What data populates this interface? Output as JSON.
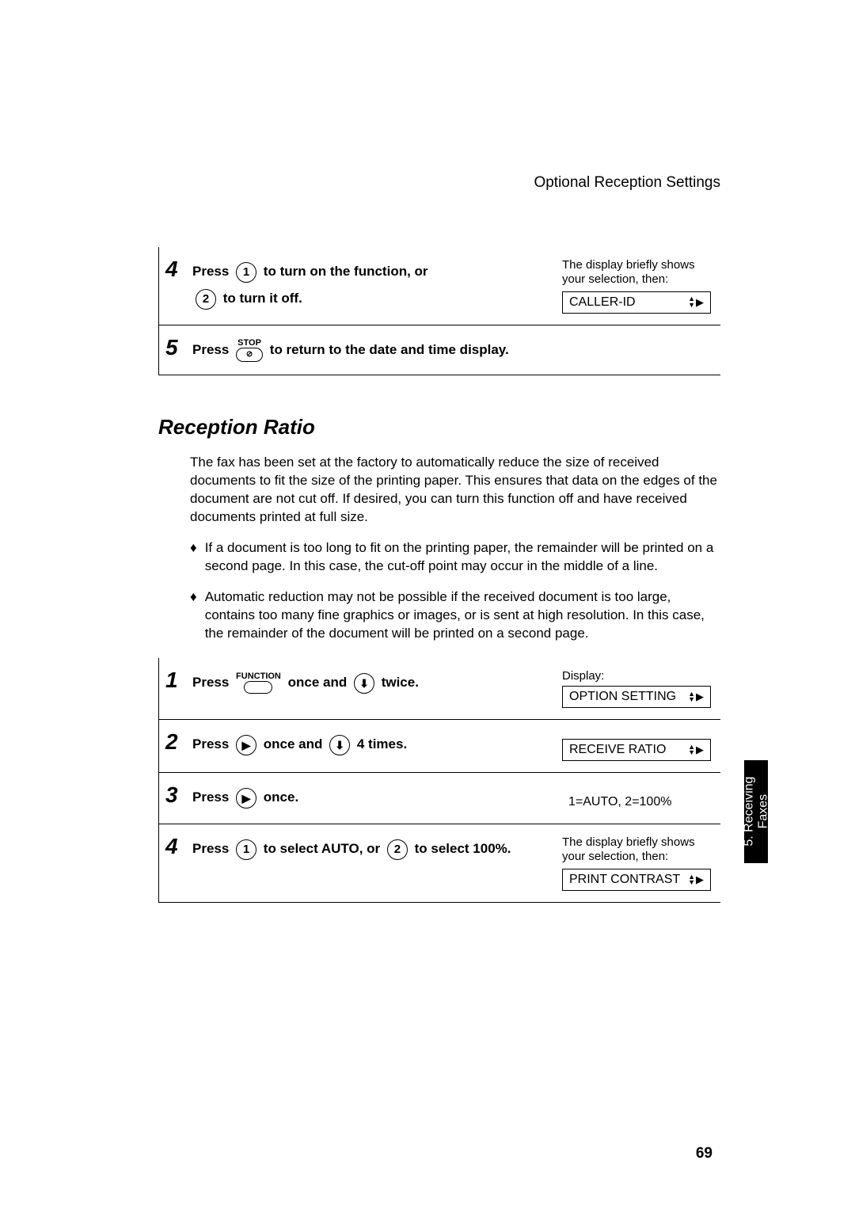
{
  "header": "Optional Reception Settings",
  "top_steps": {
    "s4": {
      "num": "4",
      "press": "Press",
      "key1": "1",
      "seg1": " to turn on the function, or ",
      "key2": "2",
      "seg2": " to turn it off.",
      "note": "The display briefly shows your selection, then:",
      "display": "CALLER-ID"
    },
    "s5": {
      "num": "5",
      "press": "Press ",
      "stop_label": "STOP",
      "stop_glyph": "⊘",
      "seg": " to return to the date and time display."
    }
  },
  "section_title": "Reception Ratio",
  "para1": "The fax has been set at the factory to automatically reduce the size of received documents to fit the size of the printing paper. This ensures that data on the edges of the document are not cut off. If desired, you can turn this function off and have received documents printed at full size.",
  "bullet1": "If a document is too long to fit on the printing paper, the remainder will be printed on a second page. In this case, the cut-off point may occur in the middle of a line.",
  "bullet2": "Automatic reduction may not be possible if the received document is too large, contains too many fine graphics or images, or is sent at high resolution. In this case, the remainder of the document will be printed on a second page.",
  "diamond": "♦",
  "steps": {
    "s1": {
      "num": "1",
      "press": "Press ",
      "func_label": "FUNCTION",
      "seg1": " once and ",
      "down_glyph": "⬇",
      "seg2": " twice.",
      "display_label": "Display:",
      "display": "OPTION SETTING"
    },
    "s2": {
      "num": "2",
      "press": "Press ",
      "right_glyph": "▶",
      "seg1": " once and ",
      "down_glyph": "⬇",
      "seg2": " 4 times.",
      "display": "RECEIVE RATIO"
    },
    "s3": {
      "num": "3",
      "press": "Press ",
      "right_glyph": "▶",
      "seg": " once.",
      "display": "1=AUTO, 2=100%"
    },
    "s4": {
      "num": "4",
      "press": "Press ",
      "key1": "1",
      "seg1": " to select AUTO, or ",
      "key2": "2",
      "seg2": " to select 100%.",
      "note": "The display briefly shows your selection, then:",
      "display": "PRINT CONTRAST"
    }
  },
  "side_tab": "5. Receiving\nFaxes",
  "page_number": "69",
  "nav": {
    "up": "▲",
    "down": "▼",
    "right": "▶"
  }
}
